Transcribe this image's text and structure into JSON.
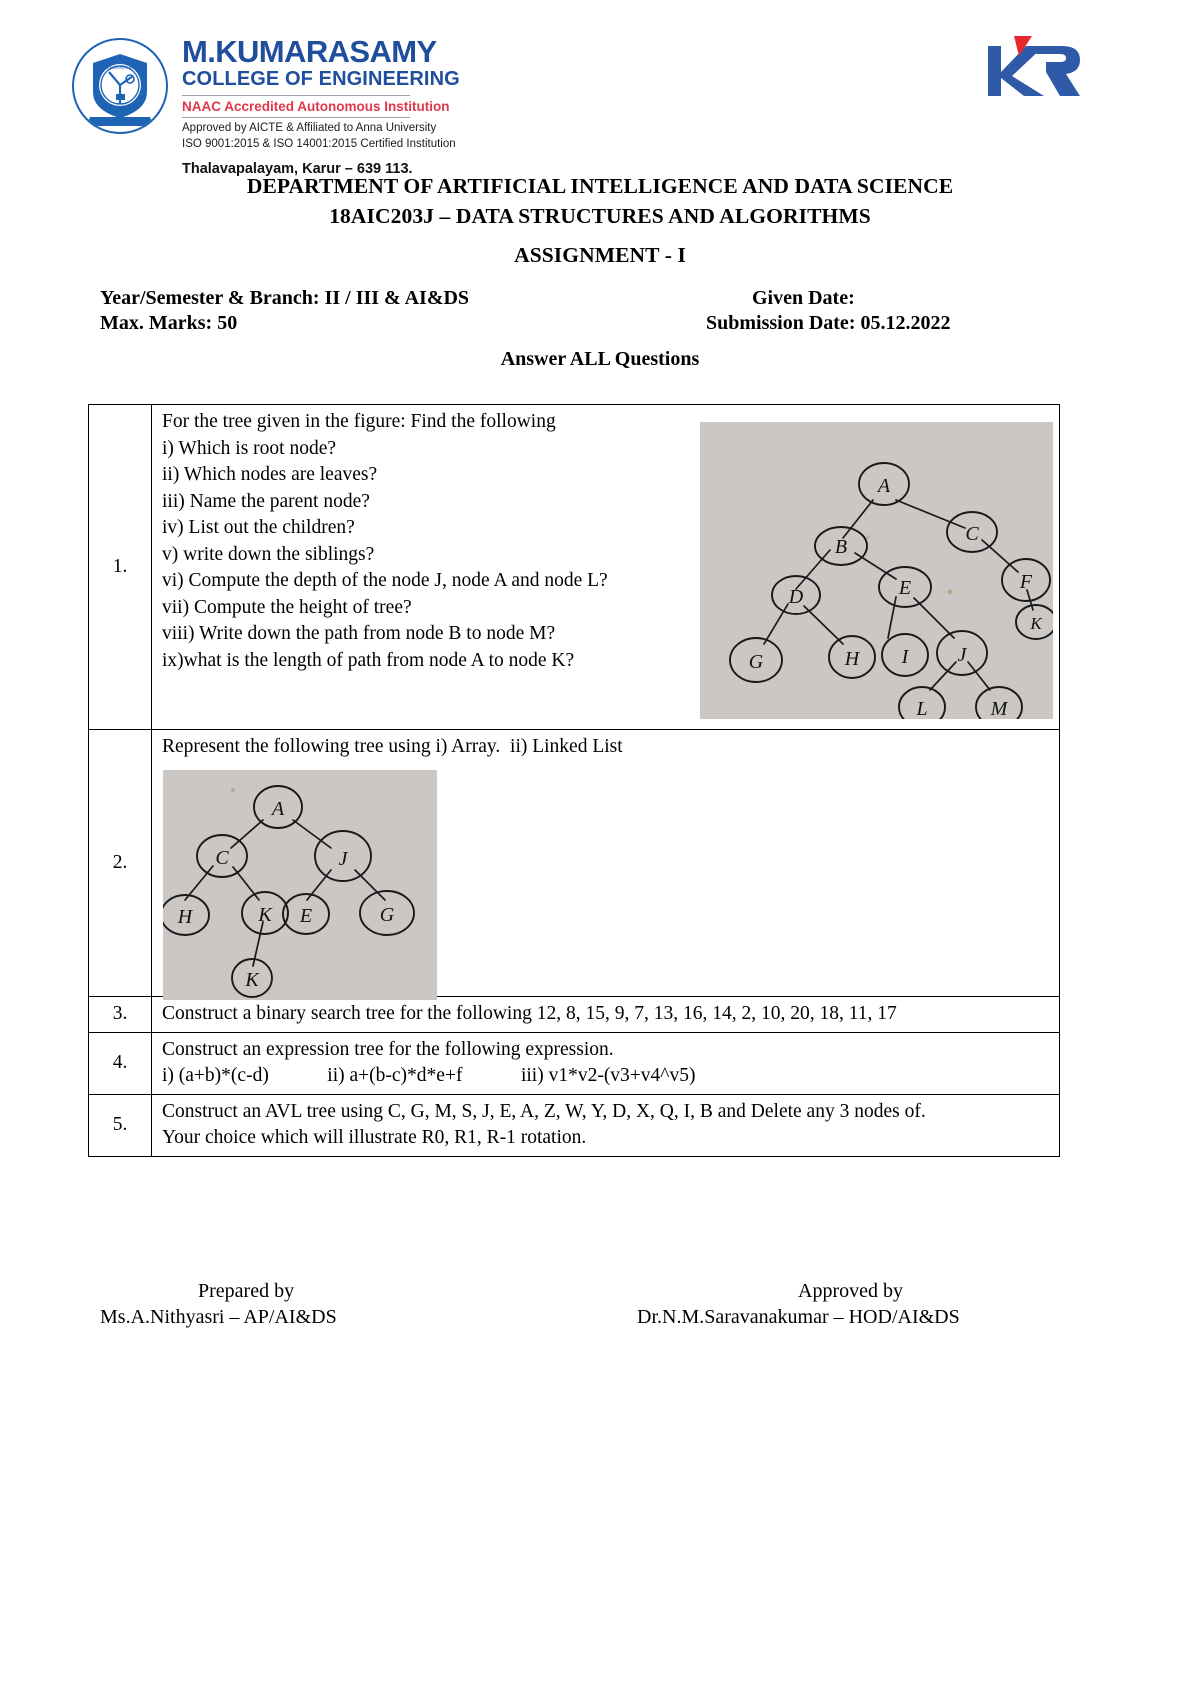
{
  "letterhead": {
    "college_name": "M.KUMARASAMY",
    "college_sub": "COLLEGE OF ENGINEERING",
    "naac": "NAAC Accredited Autonomous Institution",
    "approved": "Approved by AICTE & Affiliated to Anna University",
    "iso": "ISO 9001:2015 & ISO 14001:2015 Certified Institution",
    "address": "Thalavapalayam, Karur – 639 113.",
    "crest_icon": "college-crest-icon",
    "right_logo_icon": "kr-logo-icon",
    "brand_color": "#1f4e9c",
    "accent_color": "#e0384a"
  },
  "titles": {
    "department": "DEPARTMENT OF ARTIFICIAL INTELLIGENCE AND DATA SCIENCE",
    "course": "18AIC203J – DATA STRUCTURES AND ALGORITHMS",
    "assignment": "ASSIGNMENT - I"
  },
  "meta": {
    "year_sem_branch": "Year/Semester & Branch: II / III & AI&DS",
    "max_marks": "Max. Marks: 50",
    "given_date": "Given Date:",
    "submission_date": "Submission Date: 05.12.2022",
    "answer_all": "Answer ALL Questions"
  },
  "questions": [
    {
      "number": "1.",
      "lines": [
        "For the tree given in the figure: Find the following",
        "i) Which is root node?",
        "ii) Which nodes are leaves?",
        "iii) Name the parent node?",
        "iv) List out the children?",
        "v) write down the siblings?",
        "vi) Compute the depth of the node J, node A and node L?",
        "vii) Compute the height of tree?",
        "viii) Write down the path from node B to node M?",
        "ix)what is the length of path from node A to node K?"
      ],
      "figure": "handdrawn-tree-figure-1"
    },
    {
      "number": "2.",
      "lines": [
        "Represent the following tree using i) Array.  ii) Linked List"
      ],
      "figure": "handdrawn-tree-figure-2"
    },
    {
      "number": "3.",
      "lines": [
        "Construct a binary search tree for the following 12, 8, 15, 9, 7, 13, 16, 14, 2, 10, 20, 18, 11, 17"
      ]
    },
    {
      "number": "4.",
      "lines": [
        "Construct an expression tree for the following expression.",
        "i) (a+b)*(c-d)            ii) a+(b-c)*d*e+f            iii) v1*v2-(v3+v4^v5)"
      ]
    },
    {
      "number": "5.",
      "lines": [
        "Construct an AVL tree using C, G, M, S, J, E, A, Z, W, Y, D, X, Q, I, B and Delete any 3 nodes of.",
        "Your choice which will illustrate R0, R1, R-1 rotation."
      ]
    }
  ],
  "figure_1_nodes": [
    "A",
    "B",
    "C",
    "D",
    "E",
    "F",
    "G",
    "H",
    "I",
    "J",
    "K",
    "L",
    "M"
  ],
  "figure_2_nodes": [
    "A",
    "C",
    "J",
    "H",
    "K",
    "E",
    "G",
    "K"
  ],
  "footer": {
    "prepared_by_label": "Prepared by",
    "prepared_by_name": "Ms.A.Nithyasri – AP/AI&DS",
    "approved_by_label": "Approved by",
    "approved_by_name": "Dr.N.M.Saravanakumar – HOD/AI&DS"
  }
}
